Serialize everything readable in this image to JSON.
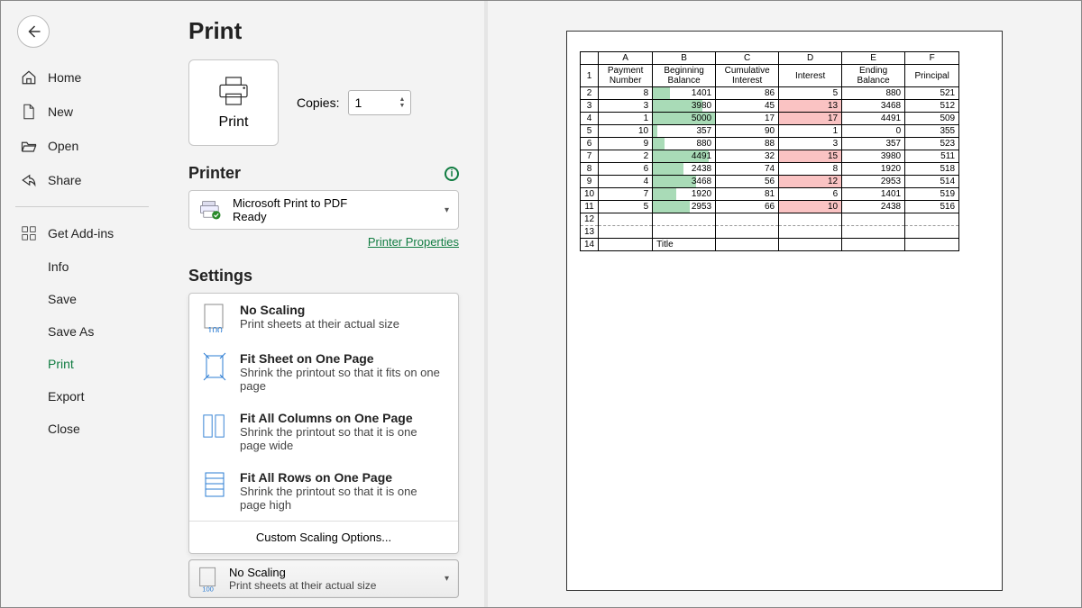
{
  "page_title": "Print",
  "print_button": "Print",
  "copies": {
    "label": "Copies:",
    "value": "1"
  },
  "nav": {
    "home": "Home",
    "new": "New",
    "open": "Open",
    "share": "Share",
    "addins": "Get Add-ins",
    "info": "Info",
    "save": "Save",
    "saveas": "Save As",
    "print": "Print",
    "export": "Export",
    "close": "Close"
  },
  "printer": {
    "heading": "Printer",
    "name": "Microsoft Print to PDF",
    "status": "Ready",
    "props_link": "Printer Properties"
  },
  "settings": {
    "heading": "Settings",
    "options": [
      {
        "title": "No Scaling",
        "sub": "Print sheets at their actual size"
      },
      {
        "title": "Fit Sheet on One Page",
        "sub": "Shrink the printout so that it fits on one page"
      },
      {
        "title": "Fit All Columns on One Page",
        "sub": "Shrink the printout so that it is one page wide"
      },
      {
        "title": "Fit All Rows on One Page",
        "sub": "Shrink the printout so that it is one page high"
      }
    ],
    "custom": "Custom Scaling Options...",
    "collapsed": {
      "title": "No Scaling",
      "sub": "Print sheets at their actual size"
    }
  },
  "preview": {
    "cols": [
      "A",
      "B",
      "C",
      "D",
      "E",
      "F"
    ],
    "headers": [
      "Payment Number",
      "Beginning Balance",
      "Cumulative Interest",
      "Interest",
      "Ending Balance",
      "Principal"
    ],
    "rows": [
      {
        "r": 2,
        "a": 8,
        "b": 1401,
        "c": 86,
        "d": 5,
        "e": 880,
        "f": 521
      },
      {
        "r": 3,
        "a": 3,
        "b": 3980,
        "c": 45,
        "d": 13,
        "e": 3468,
        "f": 512
      },
      {
        "r": 4,
        "a": 1,
        "b": 5000,
        "c": 17,
        "d": 17,
        "e": 4491,
        "f": 509
      },
      {
        "r": 5,
        "a": 10,
        "b": 357,
        "c": 90,
        "d": 1,
        "e": 0,
        "f": 355
      },
      {
        "r": 6,
        "a": 9,
        "b": 880,
        "c": 88,
        "d": 3,
        "e": 357,
        "f": 523
      },
      {
        "r": 7,
        "a": 2,
        "b": 4491,
        "c": 32,
        "d": 15,
        "e": 3980,
        "f": 511
      },
      {
        "r": 8,
        "a": 6,
        "b": 2438,
        "c": 74,
        "d": 8,
        "e": 1920,
        "f": 518
      },
      {
        "r": 9,
        "a": 4,
        "b": 3468,
        "c": 56,
        "d": 12,
        "e": 2953,
        "f": 514
      },
      {
        "r": 10,
        "a": 7,
        "b": 1920,
        "c": 81,
        "d": 6,
        "e": 1401,
        "f": 519
      },
      {
        "r": 11,
        "a": 5,
        "b": 2953,
        "c": 66,
        "d": 10,
        "e": 2438,
        "f": 516
      }
    ],
    "maxB": 5000,
    "pinkThreshold": 10,
    "extras": [
      "12",
      "13"
    ],
    "title_row": {
      "num": "14",
      "text": "Title"
    }
  }
}
